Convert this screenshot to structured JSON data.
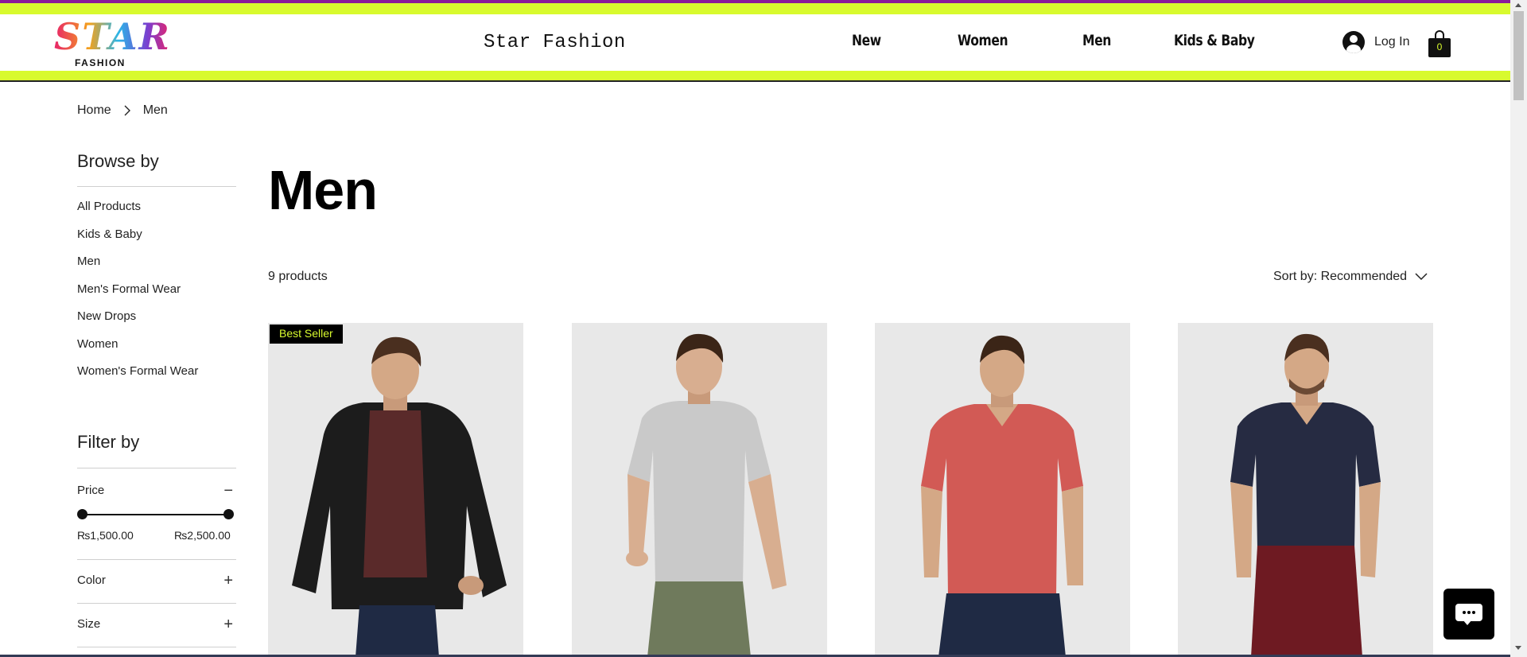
{
  "header": {
    "logo_text": "STAR",
    "logo_sub": "FASHION",
    "brand_name": "Star Fashion",
    "nav": [
      "New",
      "Women",
      "Men",
      "Kids & Baby"
    ],
    "login_label": "Log In",
    "cart_count": "0",
    "colors": {
      "lime": "#d8fa2e",
      "purple": "#8b1a9a"
    }
  },
  "breadcrumb": {
    "home": "Home",
    "current": "Men"
  },
  "browse": {
    "heading": "Browse by",
    "items": [
      "All Products",
      "Kids & Baby",
      "Men",
      "Men's Formal Wear",
      "New Drops",
      "Women",
      "Women's Formal Wear"
    ]
  },
  "filter": {
    "heading": "Filter by",
    "price_label": "Price",
    "price_min": "₨1,500.00",
    "price_max": "₨2,500.00",
    "color_label": "Color",
    "size_label": "Size"
  },
  "main": {
    "title": "Men",
    "product_count": "9 products",
    "sort_label": "Sort by: Recommended"
  },
  "products": [
    {
      "badge": "Best Seller",
      "top": "black hoodie over maroon henley",
      "shirt": "#5a2a2a",
      "jacket": "#1b1b1b",
      "pants": "#1f2a44"
    },
    {
      "badge": "",
      "top": "grey t-shirt",
      "shirt": "#c9c9c9",
      "jacket": "",
      "pants": "#6f7a5c"
    },
    {
      "badge": "",
      "top": "red v-neck t-shirt",
      "shirt": "#d25a55",
      "jacket": "",
      "pants": "#1f2a44"
    },
    {
      "badge": "",
      "top": "navy v-neck t-shirt",
      "shirt": "#262b42",
      "jacket": "",
      "pants": "#6e1a22"
    }
  ]
}
